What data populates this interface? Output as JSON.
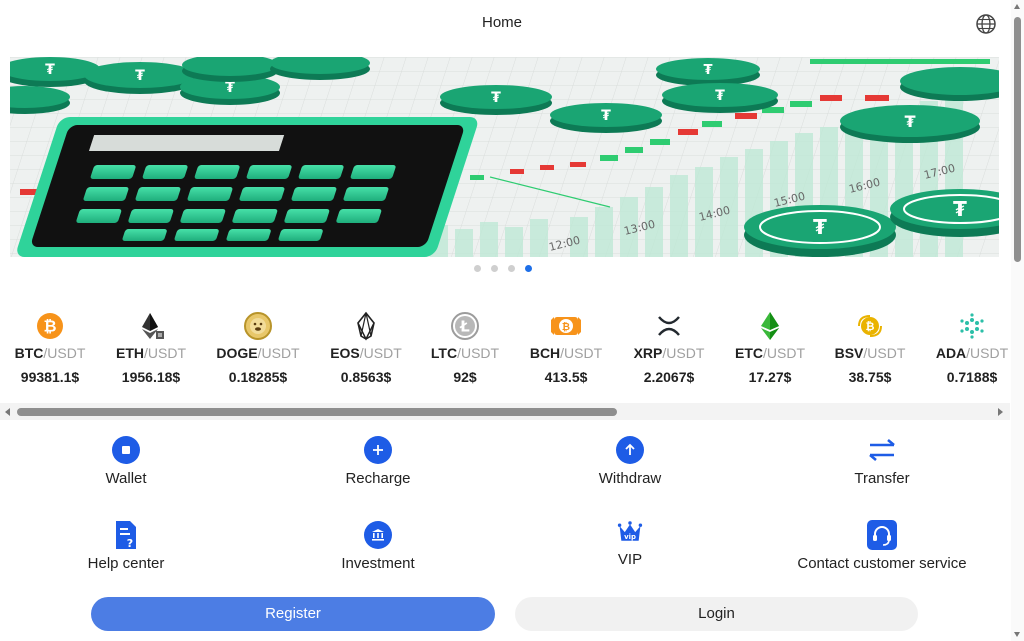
{
  "header": {
    "title": "Home",
    "language_icon": "globe-icon"
  },
  "banner": {
    "illustration": "calculator-and-tether-coins-with-candlestick-chart",
    "dots": 4,
    "active_dot": 4,
    "chart_time_labels": [
      "12:00",
      "13:00",
      "14:00",
      "15:00",
      "16:00",
      "17:00"
    ]
  },
  "ticker": [
    {
      "base": "BTC",
      "quote": "/USDT",
      "price": "99381.1$",
      "icon": "bitcoin-icon",
      "color": "#f7931a"
    },
    {
      "base": "ETH",
      "quote": "/USDT",
      "price": "1956.18$",
      "icon": "ethereum-icon",
      "color": "#333333"
    },
    {
      "base": "DOGE",
      "quote": "/USDT",
      "price": "0.18285$",
      "icon": "dogecoin-icon",
      "color": "#c2a633"
    },
    {
      "base": "EOS",
      "quote": "/USDT",
      "price": "0.8563$",
      "icon": "eos-icon",
      "color": "#222222"
    },
    {
      "base": "LTC",
      "quote": "/USDT",
      "price": "92$",
      "icon": "litecoin-icon",
      "color": "#9c9c9c"
    },
    {
      "base": "BCH",
      "quote": "/USDT",
      "price": "413.5$",
      "icon": "bitcoin-cash-icon",
      "color": "#f7931a"
    },
    {
      "base": "XRP",
      "quote": "/USDT",
      "price": "2.2067$",
      "icon": "xrp-icon",
      "color": "#23292f"
    },
    {
      "base": "ETC",
      "quote": "/USDT",
      "price": "17.27$",
      "icon": "ethereum-classic-icon",
      "color": "#3ab83a"
    },
    {
      "base": "BSV",
      "quote": "/USDT",
      "price": "38.75$",
      "icon": "bitcoin-sv-icon",
      "color": "#eab300"
    },
    {
      "base": "ADA",
      "quote": "/USDT",
      "price": "0.7188$",
      "icon": "cardano-icon",
      "color": "#2cbfa8"
    }
  ],
  "menu": {
    "wallet": "Wallet",
    "recharge": "Recharge",
    "withdraw": "Withdraw",
    "transfer": "Transfer",
    "help_center": "Help center",
    "investment": "Investment",
    "vip": "VIP",
    "vip_badge": "vip",
    "contact": "Contact customer service"
  },
  "actions": {
    "register": "Register",
    "login": "Login"
  },
  "colors": {
    "accent": "#1e5ce6",
    "register_button": "#4c7de4",
    "login_button": "#f1f1f1",
    "active_dot": "#1e6fe8"
  }
}
